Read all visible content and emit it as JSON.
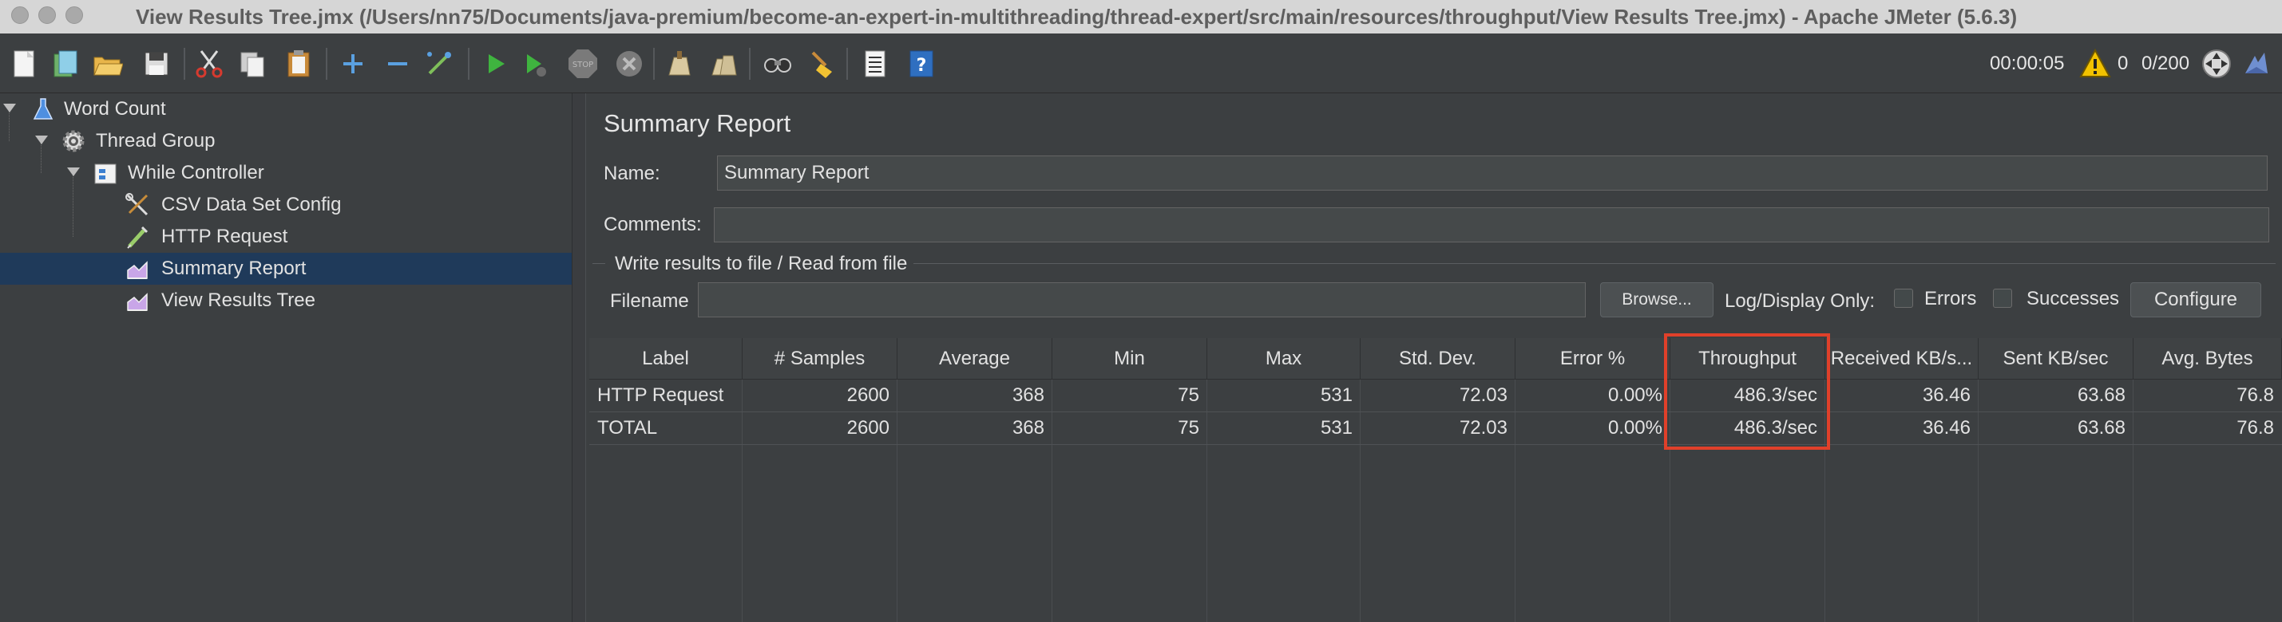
{
  "window": {
    "title": "View Results Tree.jmx (/Users/nn75/Documents/java-premium/become-an-expert-in-multithreading/thread-expert/src/main/resources/throughput/View Results Tree.jmx) - Apache JMeter (5.6.3)"
  },
  "toolbar": {
    "icons": [
      "new-icon",
      "templates-icon",
      "open-icon",
      "save-icon",
      "cut-icon",
      "copy-icon",
      "paste-icon",
      "expand-icon",
      "collapse-icon",
      "toggle-icon",
      "start-icon",
      "start-no-pauses-icon",
      "stop-icon",
      "shutdown-icon",
      "clear-icon",
      "clear-all-icon",
      "search-icon",
      "reset-search-icon",
      "function-helper-icon",
      "help-icon"
    ],
    "elapsed": "00:00:05",
    "warnings": "0",
    "threads": "0/200"
  },
  "tree": {
    "items": [
      {
        "label": "Word Count",
        "icon": "test-plan-icon"
      },
      {
        "label": "Thread Group",
        "icon": "gear-icon"
      },
      {
        "label": "While Controller",
        "icon": "controller-icon"
      },
      {
        "label": "CSV Data Set Config",
        "icon": "config-tools-icon"
      },
      {
        "label": "HTTP Request",
        "icon": "sampler-icon"
      },
      {
        "label": "Summary Report",
        "icon": "listener-icon"
      },
      {
        "label": "View Results Tree",
        "icon": "listener-icon"
      }
    ],
    "selected_index": 5
  },
  "panel": {
    "title": "Summary Report",
    "name_label": "Name:",
    "name_value": "Summary Report",
    "comments_label": "Comments:",
    "comments_value": "",
    "file_group_title": "Write results to file / Read from file",
    "filename_label": "Filename",
    "filename_value": "",
    "browse_label": "Browse...",
    "log_display_label": "Log/Display Only:",
    "errors_label": "Errors",
    "successes_label": "Successes",
    "configure_label": "Configure"
  },
  "table": {
    "headers": [
      "Label",
      "# Samples",
      "Average",
      "Min",
      "Max",
      "Std. Dev.",
      "Error %",
      "Throughput",
      "Received KB/s...",
      "Sent KB/sec",
      "Avg. Bytes"
    ],
    "rows": [
      [
        "HTTP Request",
        "2600",
        "368",
        "75",
        "531",
        "72.03",
        "0.00%",
        "486.3/sec",
        "36.46",
        "63.68",
        "76.8"
      ],
      [
        "TOTAL",
        "2600",
        "368",
        "75",
        "531",
        "72.03",
        "0.00%",
        "486.3/sec",
        "36.46",
        "63.68",
        "76.8"
      ]
    ],
    "highlighted_column": "Throughput"
  },
  "colors": {
    "background": "#3c3f41",
    "selection": "#1f3a5a",
    "highlight": "#e0402a"
  }
}
